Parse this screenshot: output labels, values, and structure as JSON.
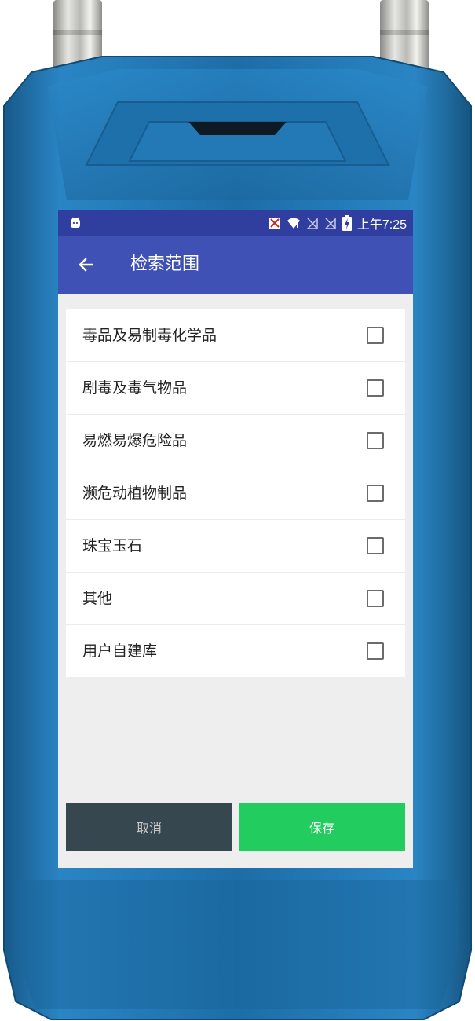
{
  "status_bar": {
    "time": "上午7:25",
    "icons": [
      "android-icon",
      "sim-icon",
      "wifi-icon",
      "signal-icon",
      "signal-icon",
      "battery-charging-icon"
    ]
  },
  "app_bar": {
    "title": "检索范围",
    "back_icon": "arrow-left-icon"
  },
  "list": {
    "items": [
      {
        "label": "毒品及易制毒化学品",
        "checked": false
      },
      {
        "label": "剧毒及毒气物品",
        "checked": false
      },
      {
        "label": "易燃易爆危险品",
        "checked": false
      },
      {
        "label": "濒危动植物制品",
        "checked": false
      },
      {
        "label": "珠宝玉石",
        "checked": false
      },
      {
        "label": "其他",
        "checked": false
      },
      {
        "label": "用户自建库",
        "checked": false
      }
    ]
  },
  "actions": {
    "cancel_label": "取消",
    "save_label": "保存"
  },
  "colors": {
    "status_bar": "#303f9f",
    "app_bar": "#3f51b5",
    "cancel": "#37474f",
    "save": "#22cc5e",
    "device_body": "#1f6fa8"
  }
}
